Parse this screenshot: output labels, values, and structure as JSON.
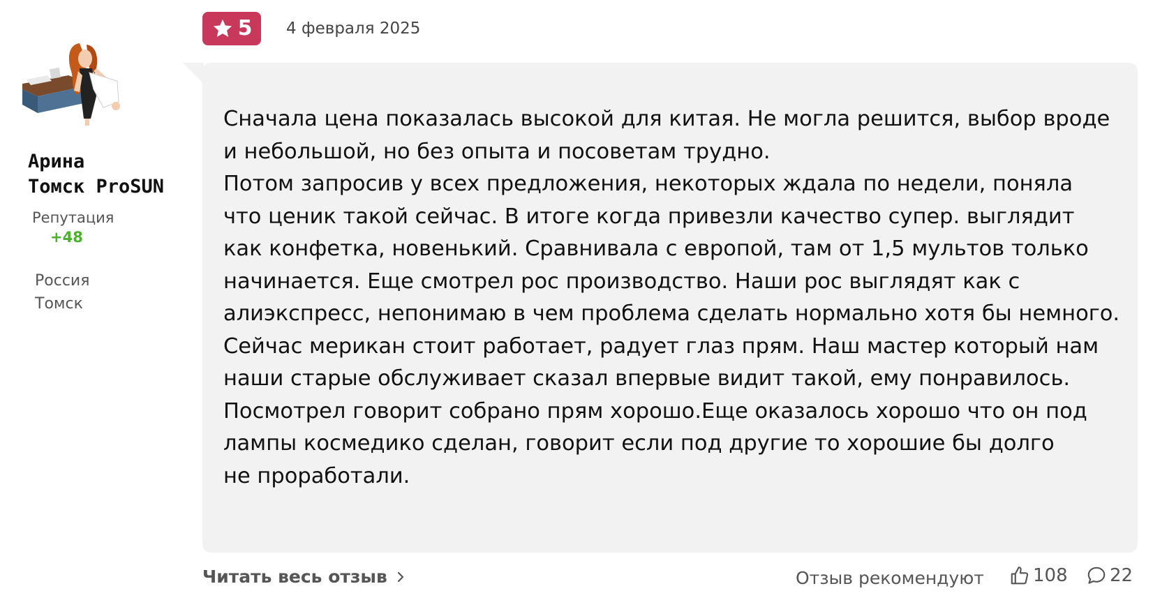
{
  "user": {
    "name_line1": "Арина",
    "name_line2": "Томск ProSUN",
    "reputation_label": "Репутация",
    "reputation_value": "+48",
    "country": "Россия",
    "city": "Томск",
    "avatar_icon": "cartoon-woman-at-desk-avatar"
  },
  "review": {
    "rating": "5",
    "rating_icon": "star-icon",
    "date": "4 февраля 2025",
    "lines": [
      "Сначала цена показалась высокой для китая. Не могла решится, выбор вроде",
      "и небольшой, но без опыта и посоветам трудно.",
      "Потом запросив у всех предложения, некоторых ждала по недели, поняла",
      "что ценик такой сейчас. В итоге когда привезли качество супер. выглядит",
      "как конфетка, новенький. Сравнивала с европой, там от 1,5 мультов только",
      "начинается. Еще смотрел рос производство. Наши рос выглядят как с",
      "алиэкспресс, непонимаю в чем проблема сделать нормально хотя бы немного.",
      "Сейчас мерикан стоит работает, радует глаз прям. Наш мастер который нам",
      "наши старые обслуживает сказал впервые видит такой, ему понравилось.",
      "Посмотрел говорит собрано прям хорошо.Еще оказалось хорошо что он под",
      "лампы космедико сделан, говорит если под другие то хорошие бы долго",
      "не проработали."
    ]
  },
  "footer": {
    "read_more": "Читать весь отзыв",
    "recommend_label": "Отзыв рекомендуют",
    "likes": "108",
    "comments": "22"
  },
  "colors": {
    "badge": "#c8385a",
    "reputation": "#4caf2d",
    "bubble": "#f2f2f2"
  }
}
